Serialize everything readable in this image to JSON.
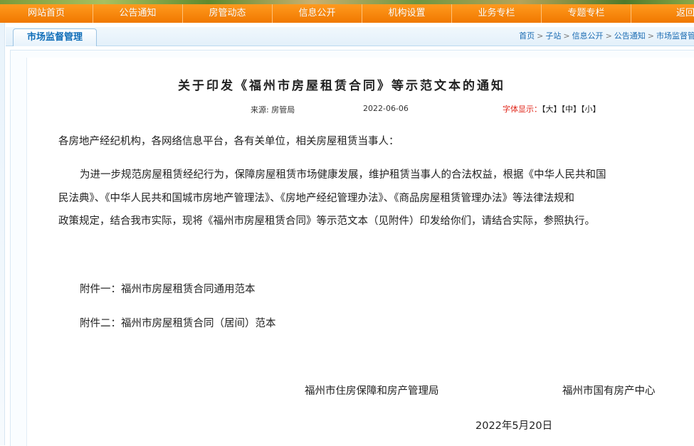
{
  "nav": {
    "items": [
      "网站首页",
      "公告通知",
      "房管动态",
      "信息公开",
      "机构设置",
      "业务专栏",
      "专题专栏",
      "返回主站"
    ]
  },
  "section": {
    "tab_label": "市场监督管理"
  },
  "breadcrumb": {
    "items": [
      "首页",
      "子站",
      "信息公开",
      "公告通知",
      "市场监督管"
    ]
  },
  "article": {
    "title": "关于印发《福州市房屋租赁合同》等示范文本的通知",
    "source": "来源: 房管局",
    "date": "2022-06-06",
    "font_size_label": "字体显示：",
    "font_large": "【大】",
    "font_medium": "【中】",
    "font_small": "【小】",
    "salutation": "各房地产经纪机构，各网络信息平台，各有关单位，相关房屋租赁当事人：",
    "body_line1": "为进一步规范房屋租赁经纪行为，保障房屋租赁市场健康发展，维护租赁当事人的合法权益，根据《中华人民共和国",
    "body_line2": "民法典》、《中华人民共和国城市房地产管理法》、《房地产经纪管理办法》、《商品房屋租赁管理办法》等法律法规和",
    "body_line3": "政策规定，结合我市实际，现将《福州市房屋租赁合同》等示范文本（见附件）印发给你们，请结合实际，参照执行。",
    "attachment1": "附件一：福州市房屋租赁合同通用范本",
    "attachment2": "附件二：福州市房屋租赁合同（居间）范本",
    "signer1": "福州市住房保障和房产管理局",
    "signer2": "福州市国有房产中心",
    "sign_date": "2022年5月20日"
  },
  "colors": {
    "nav_orange": "#f58a10",
    "tab_blue": "#0f6db8",
    "font_label_red": "#e0261a"
  }
}
